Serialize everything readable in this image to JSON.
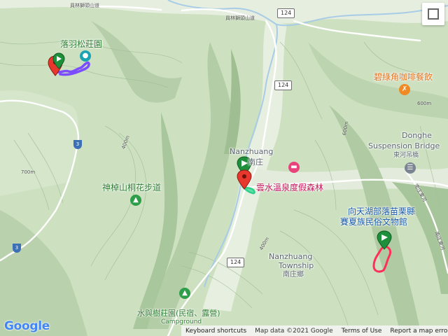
{
  "map": {
    "type": "terrain",
    "places": {
      "luoyu": "落羽松莊園",
      "shenzhang": "神棹山桐花步道",
      "nanzhuang_en": "Nanzhuang",
      "nanzhuang_zh": "南庄",
      "yunshui": "雲水溫泉度假森林",
      "bilvjiao": "碧綠角咖啡餐飲",
      "donghe_1": "Donghe",
      "donghe_2": "Suspension Bridge",
      "donghe_zh": "東河吊橋",
      "xiangtianhu_1": "向天湖部落苗栗縣",
      "xiangtianhu_2": "賽夏族民俗文物館",
      "township_1": "Nanzhuang",
      "township_2": "Township",
      "township_zh": "南庄鄉",
      "shuiyushu_1": "水與樹莊園(民宿、露營)",
      "shuiyushu_2": "Campground"
    },
    "road_labels": {
      "route_124_a": "124",
      "route_124_b": "124",
      "route_124_c": "124",
      "prov_3_a": "3",
      "prov_3_b": "3",
      "road_a": "員林獅頭山道",
      "road_b": "員林獅頭山道",
      "road_c": "南庄東河",
      "road_d": "南庄東河"
    },
    "elevations": {
      "e1": "700m",
      "e2": "400m",
      "e3": "600m",
      "e4": "400m",
      "e5": "600m"
    },
    "colors": {
      "track_purple": "#7b4dff",
      "track_green": "#2ecf8a",
      "track_red": "#ff2f5a",
      "marker_red": "#e8372c",
      "marker_green": "#1e8f3a"
    },
    "icons": {
      "luoyu": "hotel-icon",
      "shenzhang": "hiking-icon",
      "yunshui": "bed-icon",
      "bilvjiao": "restaurant-icon",
      "donghe": "bridge-icon",
      "xiangtianhu": "museum-icon",
      "shuiyushu": "campground-icon"
    }
  },
  "footer": {
    "logo": "Google",
    "keyboard": "Keyboard shortcuts",
    "map_data": "Map data ©2021 Google",
    "terms": "Terms of Use",
    "report": "Report a map error"
  }
}
